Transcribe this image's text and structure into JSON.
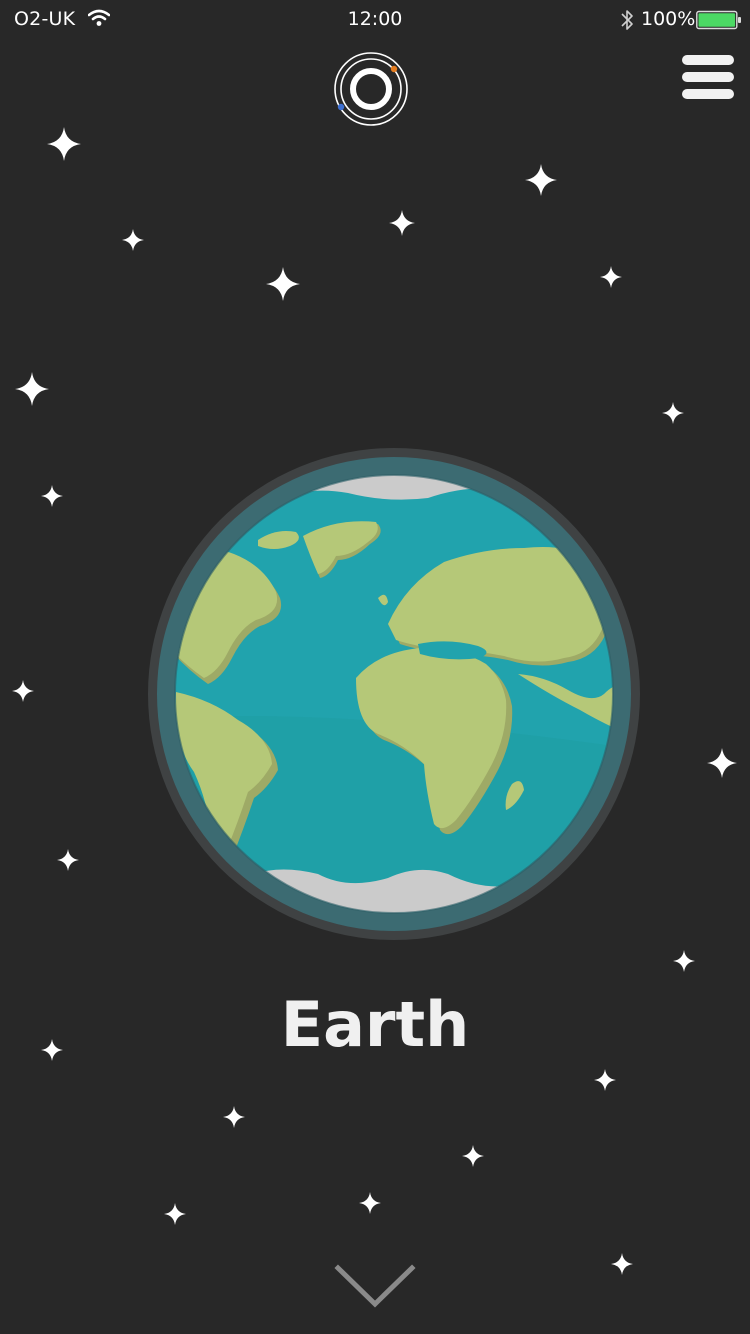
{
  "status_bar": {
    "carrier": "O2-UK",
    "time": "12:00",
    "battery_percent": "100%",
    "battery_level": 1.0,
    "icons": [
      "wifi-icon",
      "bluetooth-icon",
      "battery-icon"
    ]
  },
  "header": {
    "logo_icon": "orbit-logo-icon",
    "menu_icon": "hamburger-menu-icon"
  },
  "planet": {
    "name": "Earth",
    "illustration": "earth-globe-icon"
  },
  "footer": {
    "next_icon": "chevron-down-icon"
  },
  "colors": {
    "background": "#282828",
    "ocean": "#21a3ad",
    "land": "#b5c878",
    "ice": "#cbcbcb",
    "atmosphere_ring": "#3f4243",
    "battery": "#4cd964",
    "logo_accent_orange": "#e67e22",
    "logo_accent_blue": "#3d6fd1"
  }
}
